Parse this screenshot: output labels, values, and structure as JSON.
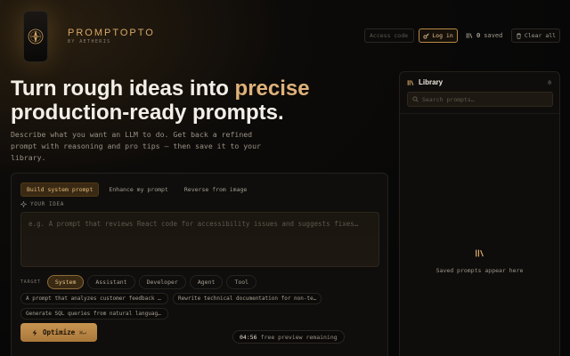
{
  "brand": {
    "name": "PROMPTOPTO",
    "sub": "BY AETHERIS",
    "logo_icon": "compass-emblem-icon"
  },
  "header": {
    "access_placeholder": "Access code",
    "login_label": "Log in",
    "saved_count": "0",
    "saved_label": "saved",
    "clear_label": "Clear all"
  },
  "hero": {
    "title_before": "Turn rough ideas into ",
    "title_accent": "precise",
    "title_after": "production-ready prompts.",
    "description": "Describe what you want an LLM to do. Get back a refined prompt with reasoning and pro tips — then save it to your library."
  },
  "builder": {
    "tabs": [
      {
        "label": "Build system prompt",
        "active": true
      },
      {
        "label": "Enhance my prompt",
        "active": false
      },
      {
        "label": "Reverse from image",
        "active": false
      }
    ],
    "idea_label": "YOUR IDEA",
    "idea_placeholder": "e.g. A prompt that reviews React code for accessibility issues and suggests fixes…",
    "target_label": "TARGET",
    "targets": [
      {
        "label": "System",
        "active": true
      },
      {
        "label": "Assistant",
        "active": false
      },
      {
        "label": "Developer",
        "active": false
      },
      {
        "label": "Agent",
        "active": false
      },
      {
        "label": "Tool",
        "active": false
      }
    ],
    "examples": [
      "A prompt that analyzes customer feedback a…",
      "Rewrite technical documentation for non-te…",
      "Generate SQL queries from natural language…"
    ],
    "optimize_label": "Optimize",
    "optimize_shortcut": "⌘↵",
    "preview_time": "04:56",
    "preview_text": "free preview remaining"
  },
  "library": {
    "title": "Library",
    "count": "0",
    "search_placeholder": "Search prompts…",
    "empty_text": "Saved prompts appear here"
  },
  "colors": {
    "accent": "#d9a866",
    "accent_bg": "#3a2a14",
    "background": "#070707"
  }
}
